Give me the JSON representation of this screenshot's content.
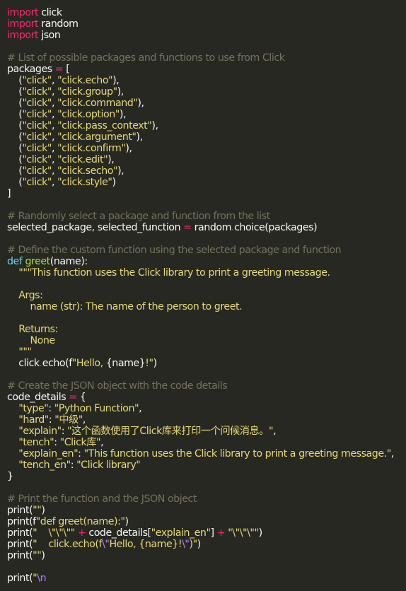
{
  "theme": {
    "background": "#272822",
    "foreground": "#f8f8f2",
    "keyword": "#f92672",
    "def_keyword": "#66d9ef",
    "string": "#e6db74",
    "comment": "#75715e",
    "function_name": "#a6e22e",
    "escape": "#ae81ff"
  },
  "code_lines": [
    [
      [
        "kw",
        "import"
      ],
      [
        "id",
        " click"
      ]
    ],
    [
      [
        "kw",
        "import"
      ],
      [
        "id",
        " random"
      ]
    ],
    [
      [
        "kw",
        "import"
      ],
      [
        "id",
        " json"
      ]
    ],
    [],
    [
      [
        "cm",
        "# List of possible packages and functions to use from Click"
      ]
    ],
    [
      [
        "id",
        "packages "
      ],
      [
        "op",
        "="
      ],
      [
        "id",
        " ["
      ]
    ],
    [
      [
        "id",
        "    ("
      ],
      [
        "str",
        "\"click\""
      ],
      [
        "id",
        ", "
      ],
      [
        "str",
        "\"click.echo\""
      ],
      [
        "id",
        "),"
      ]
    ],
    [
      [
        "id",
        "    ("
      ],
      [
        "str",
        "\"click\""
      ],
      [
        "id",
        ", "
      ],
      [
        "str",
        "\"click.group\""
      ],
      [
        "id",
        "),"
      ]
    ],
    [
      [
        "id",
        "    ("
      ],
      [
        "str",
        "\"click\""
      ],
      [
        "id",
        ", "
      ],
      [
        "str",
        "\"click.command\""
      ],
      [
        "id",
        "),"
      ]
    ],
    [
      [
        "id",
        "    ("
      ],
      [
        "str",
        "\"click\""
      ],
      [
        "id",
        ", "
      ],
      [
        "str",
        "\"click.option\""
      ],
      [
        "id",
        "),"
      ]
    ],
    [
      [
        "id",
        "    ("
      ],
      [
        "str",
        "\"click\""
      ],
      [
        "id",
        ", "
      ],
      [
        "str",
        "\"click.pass_context\""
      ],
      [
        "id",
        "),"
      ]
    ],
    [
      [
        "id",
        "    ("
      ],
      [
        "str",
        "\"click\""
      ],
      [
        "id",
        ", "
      ],
      [
        "str",
        "\"click.argument\""
      ],
      [
        "id",
        "),"
      ]
    ],
    [
      [
        "id",
        "    ("
      ],
      [
        "str",
        "\"click\""
      ],
      [
        "id",
        ", "
      ],
      [
        "str",
        "\"click.confirm\""
      ],
      [
        "id",
        "),"
      ]
    ],
    [
      [
        "id",
        "    ("
      ],
      [
        "str",
        "\"click\""
      ],
      [
        "id",
        ", "
      ],
      [
        "str",
        "\"click.edit\""
      ],
      [
        "id",
        "),"
      ]
    ],
    [
      [
        "id",
        "    ("
      ],
      [
        "str",
        "\"click\""
      ],
      [
        "id",
        ", "
      ],
      [
        "str",
        "\"click.secho\""
      ],
      [
        "id",
        "),"
      ]
    ],
    [
      [
        "id",
        "    ("
      ],
      [
        "str",
        "\"click\""
      ],
      [
        "id",
        ", "
      ],
      [
        "str",
        "\"click.style\""
      ],
      [
        "id",
        ")"
      ]
    ],
    [
      [
        "id",
        "]"
      ]
    ],
    [],
    [
      [
        "cm",
        "# Randomly select a package and function from the list"
      ]
    ],
    [
      [
        "id",
        "selected_package, selected_function "
      ],
      [
        "op",
        "="
      ],
      [
        "id",
        " random"
      ],
      [
        "op",
        "."
      ],
      [
        "id",
        "choice(packages)"
      ]
    ],
    [],
    [
      [
        "cm",
        "# Define the custom function using the selected package and function"
      ]
    ],
    [
      [
        "def",
        "def"
      ],
      [
        "id",
        " "
      ],
      [
        "fn",
        "greet"
      ],
      [
        "id",
        "(name):"
      ]
    ],
    [
      [
        "str",
        "    \"\"\"This function uses the Click library to print a greeting message."
      ]
    ],
    [],
    [
      [
        "str",
        "    Args:"
      ]
    ],
    [
      [
        "str",
        "        name (str): The name of the person to greet."
      ]
    ],
    [],
    [
      [
        "str",
        "    Returns:"
      ]
    ],
    [
      [
        "str",
        "        None"
      ]
    ],
    [
      [
        "str",
        "    \"\"\""
      ]
    ],
    [
      [
        "id",
        "    click"
      ],
      [
        "op",
        "."
      ],
      [
        "id",
        "echo(f"
      ],
      [
        "str",
        "\"Hello, "
      ],
      [
        "id",
        "{name}"
      ],
      [
        "str",
        "!\""
      ],
      [
        "id",
        ")"
      ]
    ],
    [],
    [
      [
        "cm",
        "# Create the JSON object with the code details"
      ]
    ],
    [
      [
        "id",
        "code_details "
      ],
      [
        "op",
        "="
      ],
      [
        "id",
        " {"
      ]
    ],
    [
      [
        "id",
        "    "
      ],
      [
        "str",
        "\"type\""
      ],
      [
        "id",
        ": "
      ],
      [
        "str",
        "\"Python Function\""
      ],
      [
        "id",
        ","
      ]
    ],
    [
      [
        "id",
        "    "
      ],
      [
        "str",
        "\"hard\""
      ],
      [
        "id",
        ": "
      ],
      [
        "str",
        "\"中级\""
      ],
      [
        "id",
        ","
      ]
    ],
    [
      [
        "id",
        "    "
      ],
      [
        "str",
        "\"explain\""
      ],
      [
        "id",
        ": "
      ],
      [
        "str",
        "\"这个函数使用了Click库来打印一个问候消息。\""
      ],
      [
        "id",
        ","
      ]
    ],
    [
      [
        "id",
        "    "
      ],
      [
        "str",
        "\"tench\""
      ],
      [
        "id",
        ": "
      ],
      [
        "str",
        "\"Click库\""
      ],
      [
        "id",
        ","
      ]
    ],
    [
      [
        "id",
        "    "
      ],
      [
        "str",
        "\"explain_en\""
      ],
      [
        "id",
        ": "
      ],
      [
        "str",
        "\"This function uses the Click library to print a greeting message.\""
      ],
      [
        "id",
        ","
      ]
    ],
    [
      [
        "id",
        "    "
      ],
      [
        "str",
        "\"tench_en\""
      ],
      [
        "id",
        ": "
      ],
      [
        "str",
        "\"Click library\""
      ]
    ],
    [
      [
        "id",
        "}"
      ]
    ],
    [],
    [
      [
        "cm",
        "# Print the function and the JSON object"
      ]
    ],
    [
      [
        "id",
        "print("
      ],
      [
        "str",
        "\"\""
      ],
      [
        "id",
        ")"
      ]
    ],
    [
      [
        "id",
        "print(f"
      ],
      [
        "str",
        "\"def greet(name):\""
      ],
      [
        "id",
        ")"
      ]
    ],
    [
      [
        "id",
        "print("
      ],
      [
        "str",
        "\"    \\\"\\\"\\\"\""
      ],
      [
        "id",
        " "
      ],
      [
        "op",
        "+"
      ],
      [
        "id",
        " code_details["
      ],
      [
        "str",
        "\"explain_en\""
      ],
      [
        "id",
        "] "
      ],
      [
        "op",
        "+"
      ],
      [
        "id",
        " "
      ],
      [
        "str",
        "\"\\\"\\\"\\\"\""
      ],
      [
        "id",
        ")"
      ]
    ],
    [
      [
        "id",
        "print("
      ],
      [
        "str",
        "\"    click.echo(f"
      ],
      [
        "esc",
        "\\\""
      ],
      [
        "str",
        "Hello, {name}!"
      ],
      [
        "esc",
        "\\\""
      ],
      [
        "str",
        ")\""
      ],
      [
        "id",
        ")"
      ]
    ],
    [
      [
        "id",
        "print("
      ],
      [
        "str",
        "\"\""
      ],
      [
        "id",
        ")"
      ]
    ],
    [],
    [
      [
        "id",
        "print("
      ],
      [
        "str",
        "\""
      ],
      [
        "esc",
        "\\n"
      ]
    ]
  ]
}
